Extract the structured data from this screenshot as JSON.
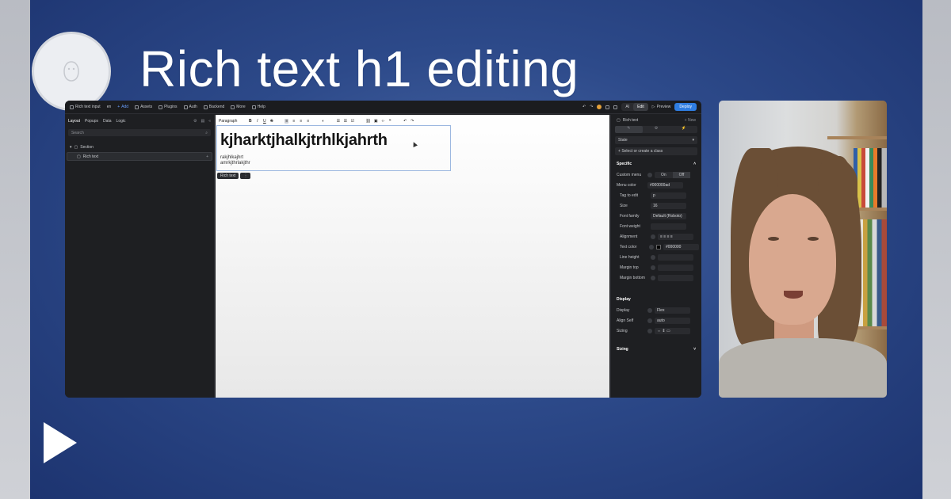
{
  "video": {
    "title": "Rich text h1 editing"
  },
  "topbar": {
    "page_name": "Rich text input",
    "lang": "en",
    "add": "Add",
    "assets": "Assets",
    "plugins": "Plugins",
    "auth": "Auth",
    "backend": "Backend",
    "more": "More",
    "help": "Help",
    "ai": "AI",
    "edit": "Edit",
    "preview": "Preview",
    "deploy": "Deploy"
  },
  "left_panel": {
    "tabs": [
      "Layout",
      "Popups",
      "Data",
      "Logic"
    ],
    "search_placeholder": "Search",
    "tree": {
      "section": "Section",
      "child": "Rich text"
    }
  },
  "canvas": {
    "toolbar": {
      "block_type": "Paragraph",
      "bold": "B",
      "italic": "I",
      "underline": "U",
      "strike": "S"
    },
    "heading": "kjharktjhalkjtrhlkjahrth",
    "para1": "rakjhlkajhrt",
    "para2": "amrkjthrlakjthr",
    "selection_tag": "Rich text"
  },
  "right_panel": {
    "title": "Rich text",
    "new": "New",
    "state": "State",
    "class_placeholder": "Select or create a class",
    "specific": "Specific",
    "custom_menu": "Custom menu",
    "on": "On",
    "off": "Off",
    "menu_color_label": "Menu color",
    "menu_color": "#000000ad",
    "tag_to_edit_label": "Tag to edit",
    "tag_to_edit": "p",
    "size_label": "Size",
    "size": "16",
    "font_family_label": "Font family",
    "font_family": "Default (Roboto)",
    "font_weight_label": "Font weight",
    "alignment_label": "Alignment",
    "text_color_label": "Text color",
    "text_color": "#000000",
    "line_height_label": "Line height",
    "margin_top_label": "Margin top",
    "margin_bottom_label": "Margin bottom",
    "display_section": "Display",
    "display_label": "Display",
    "display_value": "Flex",
    "align_self_label": "Align Self",
    "align_self_value": "auto",
    "sizing_label": "Sizing",
    "spacing_section": "Sizing"
  },
  "colors": {
    "accent": "#2f7de1",
    "background": "#2d4a8a",
    "panel": "#1e1f22"
  }
}
